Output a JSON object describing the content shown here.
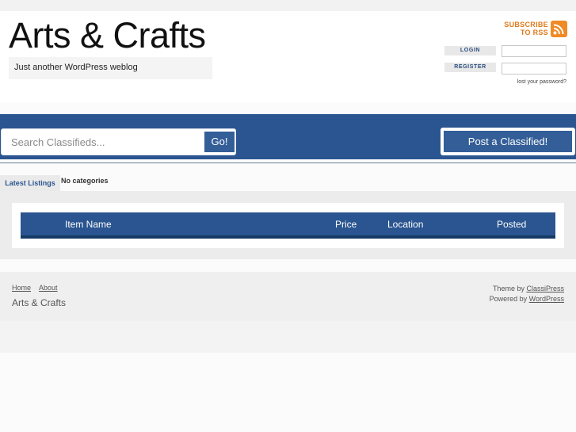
{
  "site": {
    "title": "Arts & Crafts",
    "tagline": "Just another WordPress weblog"
  },
  "rss": {
    "line1": "SUBSCRIBE",
    "line2": "TO RSS",
    "icon": "rss-icon",
    "color": "#f08a24"
  },
  "auth": {
    "login_label": "LOGIN",
    "register_label": "REGISTER",
    "lost_password": "lost your password?",
    "login_value": "",
    "register_value": ""
  },
  "search": {
    "placeholder": "Search Classifieds...",
    "button": "Go!"
  },
  "post_button": "Post a Classified!",
  "tabs": {
    "latest": "Latest Listings",
    "categories": "No categories"
  },
  "table": {
    "columns": [
      "Item Name",
      "Price",
      "Location",
      "Posted"
    ]
  },
  "footer": {
    "links": [
      "Home",
      "About"
    ],
    "title": "Arts & Crafts",
    "theme_prefix": "Theme by",
    "theme_link": "ClassiPress",
    "powered_prefix": "Powered by",
    "powered_link": "WordPress"
  },
  "colors": {
    "accent": "#2a5590",
    "accent_dark": "#163a66",
    "rss": "#f08a24"
  }
}
